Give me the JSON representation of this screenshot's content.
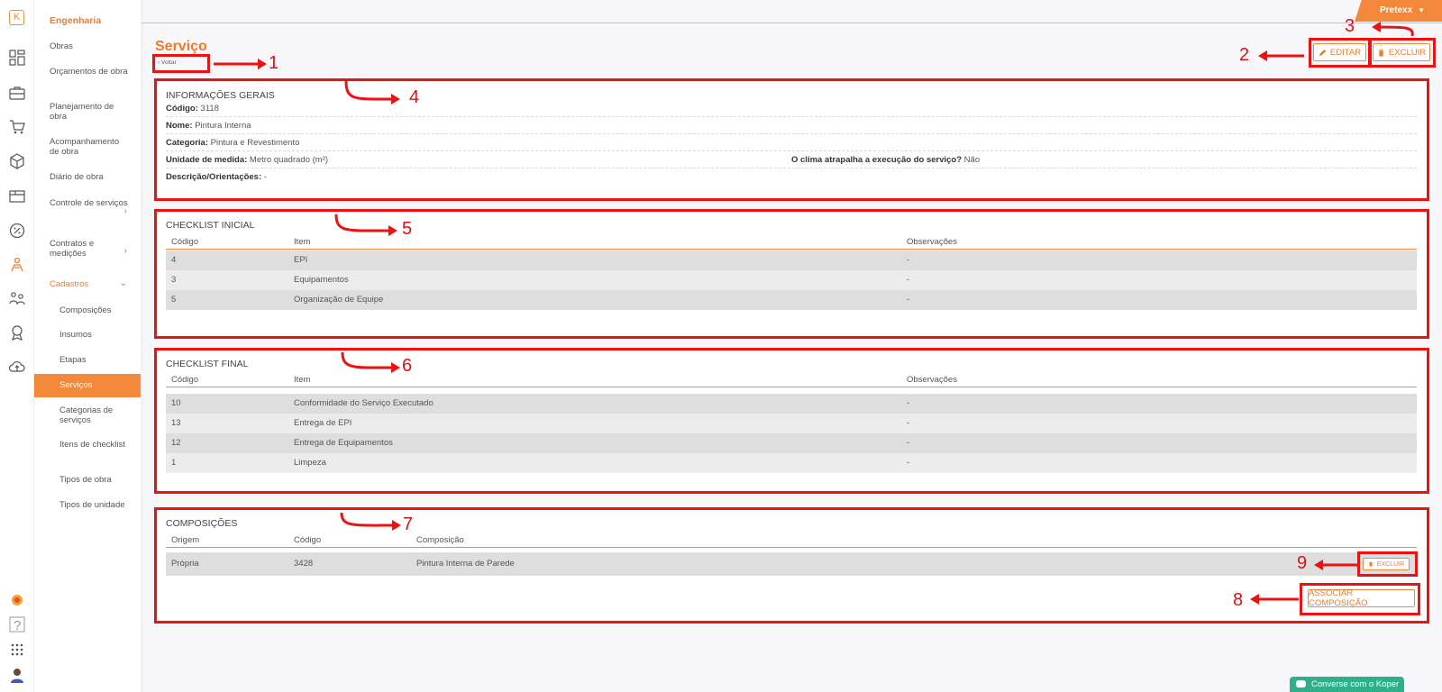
{
  "user": {
    "name": "Pretexx"
  },
  "nav": {
    "section": "Engenharia",
    "items": [
      "Obras",
      "Orçamentos de obra",
      "Planejamento de obra",
      "Acompanhamento de obra",
      "Diário de obra",
      "Controle de serviços",
      "Contratos e medições",
      "Cadastros"
    ],
    "sub_items": [
      "Composições",
      "Insumos",
      "Etapas",
      "Serviços",
      "Categorias de serviços",
      "Itens de checklist",
      "Tipos de obra",
      "Tipos de unidade"
    ],
    "active": "Serviços"
  },
  "page": {
    "title": "Serviço",
    "back_label": "Voltar"
  },
  "actions": {
    "edit_label": "EDITAR",
    "delete_label": "EXCLUIR"
  },
  "info": {
    "title": "INFORMAÇÕES GERAIS",
    "codigo_label": "Código:",
    "codigo": "3118",
    "nome_label": "Nome:",
    "nome": "Pintura Interna",
    "categoria_label": "Categoria:",
    "categoria": "Pintura e Revestimento",
    "unidade_label": "Unidade de medida:",
    "unidade": "Metro quadrado (m²)",
    "clima_label": "O clima atrapalha a execução do serviço?",
    "clima": "Não",
    "descricao_label": "Descrição/Orientações:",
    "descricao": "-"
  },
  "checklist_inicial": {
    "title": "CHECKLIST INICIAL",
    "headers": [
      "Código",
      "Item",
      "Observações"
    ],
    "rows": [
      [
        "4",
        "EPI",
        "-"
      ],
      [
        "3",
        "Equipamentos",
        "-"
      ],
      [
        "5",
        "Organização de Equipe",
        "-"
      ]
    ]
  },
  "checklist_final": {
    "title": "CHECKLIST FINAL",
    "headers": [
      "Código",
      "Item",
      "Observações"
    ],
    "rows": [
      [
        "10",
        "Conformidade do Serviço Executado",
        "-"
      ],
      [
        "13",
        "Entrega de EPI",
        "-"
      ],
      [
        "12",
        "Entrega de Equipamentos",
        "-"
      ],
      [
        "1",
        "Limpeza",
        "-"
      ]
    ]
  },
  "composicoes": {
    "title": "COMPOSIÇÕES",
    "headers": [
      "Origem",
      "Código",
      "Composição"
    ],
    "rows": [
      [
        "Própria",
        "3428",
        "Pintura Interna de Parede"
      ]
    ],
    "row_delete_label": "EXCLUIR",
    "associate_label": "ASSOCIAR COMPOSIÇÃO"
  },
  "annotations": [
    "1",
    "2",
    "3",
    "4",
    "5",
    "6",
    "7",
    "8",
    "9"
  ],
  "chat": {
    "label": "Converse com o Koper"
  },
  "colors": {
    "accent": "#f3873a",
    "annotation": "#ee1111",
    "chat": "#2fb08a"
  }
}
